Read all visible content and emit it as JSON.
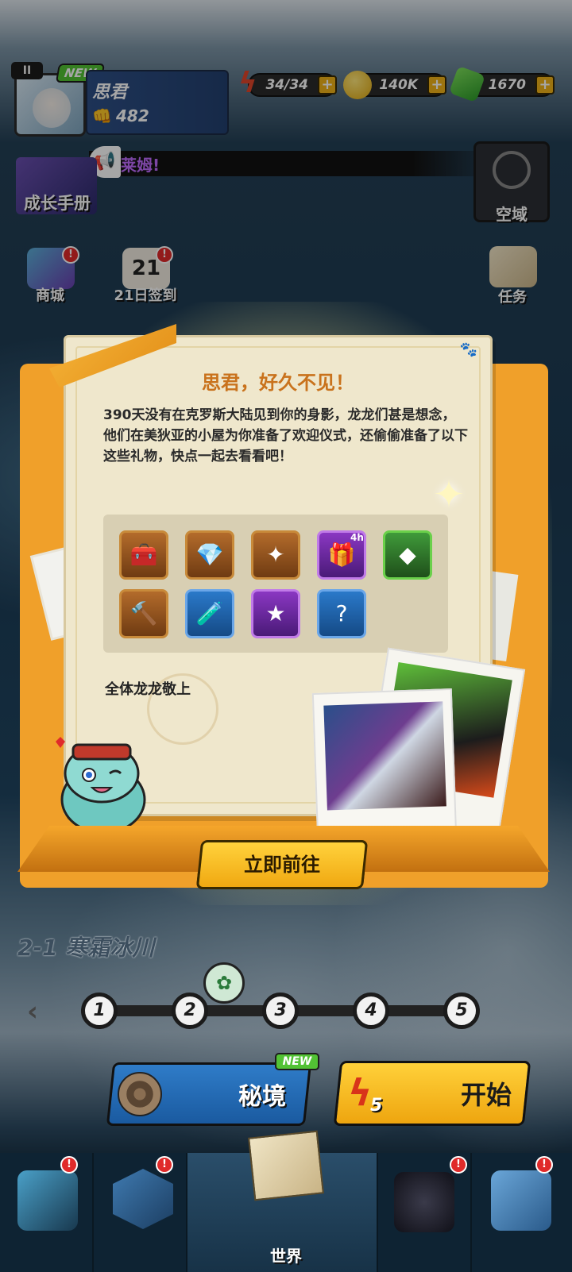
{
  "header": {
    "pause_label": "II",
    "new_badge": "NEW",
    "player_name": "思君",
    "power": "482",
    "energy": "34/34",
    "gold": "140K",
    "gems": "1670",
    "plus": "+"
  },
  "announcement": {
    "text": "莱姆!"
  },
  "side_left": [
    {
      "label": "成长手册"
    },
    {
      "label": "商城"
    },
    {
      "label": "21日签到",
      "day": "21"
    }
  ],
  "side_right": [
    {
      "label": "空域"
    },
    {
      "label": "任务"
    }
  ],
  "dialog": {
    "title": "思君，好久不见！",
    "body": "390天没有在克罗斯大陆见到你的身影，龙龙们甚是想念，他们在美狄亚的小屋为你准备了欢迎仪式，还偷偷准备了以下这些礼物，快点一起去看看吧！",
    "signature": "全体龙龙敬上",
    "gift_timer": "4h",
    "go_button": "立即前往"
  },
  "gifts": [
    {
      "icon": "treasure-chest-icon",
      "glyph": "🧰",
      "tone": "brown"
    },
    {
      "icon": "green-gems-icon",
      "glyph": "💎",
      "tone": "brown"
    },
    {
      "icon": "blue-star-icon",
      "glyph": "✦",
      "tone": "brown"
    },
    {
      "icon": "gold-chest-timed-icon",
      "glyph": "🎁",
      "tone": "purple"
    },
    {
      "icon": "green-crystal-icon",
      "glyph": "◆",
      "tone": "green"
    },
    {
      "icon": "hammer-icon",
      "glyph": "🔨",
      "tone": "brown"
    },
    {
      "icon": "potion-icon",
      "glyph": "🧪",
      "tone": "blue"
    },
    {
      "icon": "yellow-star-icon",
      "glyph": "★",
      "tone": "purple"
    },
    {
      "icon": "mystery-chest-icon",
      "glyph": "?",
      "tone": "blue"
    }
  ],
  "stage": {
    "name": "2-1 寒霜冰川",
    "nodes": [
      "1",
      "2",
      "3",
      "4",
      "5"
    ],
    "prev_arrow": "‹"
  },
  "actions": {
    "secret_label": "秘境",
    "secret_badge": "NEW",
    "start_label": "开始",
    "start_cost": "5"
  },
  "nav": {
    "active_label": "世界",
    "alert": "!"
  },
  "colors": {
    "accent_gold": "#f0a811",
    "board_orange": "#f0a02a",
    "title_orange": "#c9721c",
    "paper": "#efe7cc",
    "badge_green": "#52c234",
    "alert_red": "#e02a2a"
  }
}
